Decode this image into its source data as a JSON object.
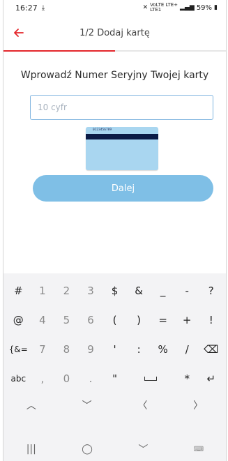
{
  "status_bar": {
    "time": "16:27",
    "lte_top": "VoLTE LTE+",
    "lte_bottom": "LTE1",
    "battery": "59%"
  },
  "app_bar": {
    "title": "1/2 Dodaj kartę",
    "progress_fraction": 0.5,
    "accent_color": "#e4262b"
  },
  "main": {
    "heading": "Wprowadź Numer Seryjny Twojej karty",
    "serial_input": {
      "placeholder": "10 cyfr",
      "value": ""
    },
    "card_example": {
      "serial": "0123456789"
    },
    "next_button": {
      "label": "Dalej",
      "color": "#7fbfe6"
    }
  },
  "keyboard": {
    "rows": [
      [
        "#",
        "1",
        "2",
        "3",
        "$",
        "&",
        "_",
        "-",
        "?"
      ],
      [
        "@",
        "4",
        "5",
        "6",
        "(",
        ")",
        "=",
        "+",
        "!"
      ],
      [
        "{&=",
        "7",
        "8",
        "9",
        "'",
        ":",
        "%",
        "/",
        "⌫"
      ],
      [
        "abc",
        ",",
        "0",
        ".",
        "\"",
        "space",
        "*",
        "↵"
      ]
    ],
    "nav_row": [
      "︿",
      "﹀",
      "〈",
      "〉"
    ],
    "system_nav": [
      "|||",
      "◯",
      "﹀",
      "⌨"
    ]
  }
}
